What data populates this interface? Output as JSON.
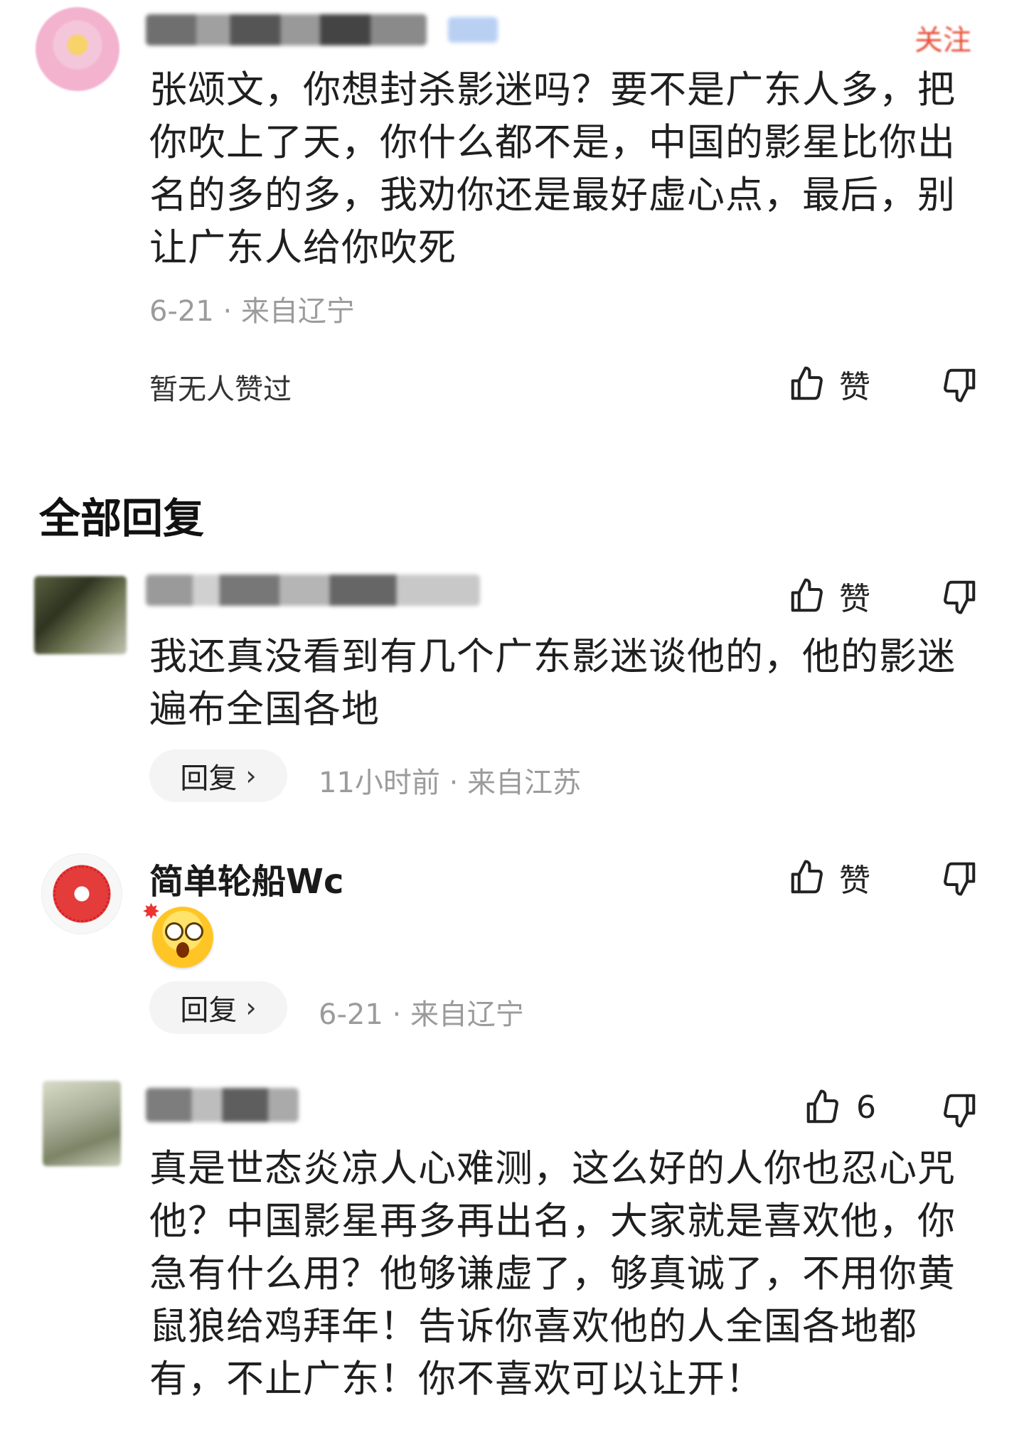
{
  "top_comment": {
    "follow_label": "关注",
    "text": "张颂文，你想封杀影迷吗？要不是广东人多，把你吹上了天，你什么都不是，中国的影星比你出名的多的多，我劝你还是最好虚心点，最后，别让广东人给你吹死",
    "date": "6-21",
    "location": "来自辽宁",
    "likes_info": "暂无人赞过",
    "like_label": "赞"
  },
  "section": {
    "title": "全部回复"
  },
  "replies": [
    {
      "username": "",
      "text": "我还真没看到有几个广东影迷谈他的，他的影迷遍布全国各地",
      "reply_label": "回复",
      "time": "11小时前",
      "location": "来自江苏",
      "like_label": "赞"
    },
    {
      "username": "简单轮船Wc",
      "emoji": "astonished-face",
      "reply_label": "回复",
      "time": "6-21",
      "location": "来自辽宁",
      "like_label": "赞"
    },
    {
      "username": "",
      "text": "真是世态炎凉人心难测，这么好的人你也忍心咒他？中国影星再多再出名，大家就是喜欢他，你急有什么用？他够谦虚了，够真诚了，不用你黄鼠狼给鸡拜年！告诉你喜欢他的人全国各地都有，不止广东！你不喜欢可以让开！",
      "like_count": "6"
    }
  ],
  "separator": "·",
  "colors": {
    "follow": "#e8503a",
    "meta": "#9b9b9b",
    "text": "#1f1f1f"
  }
}
